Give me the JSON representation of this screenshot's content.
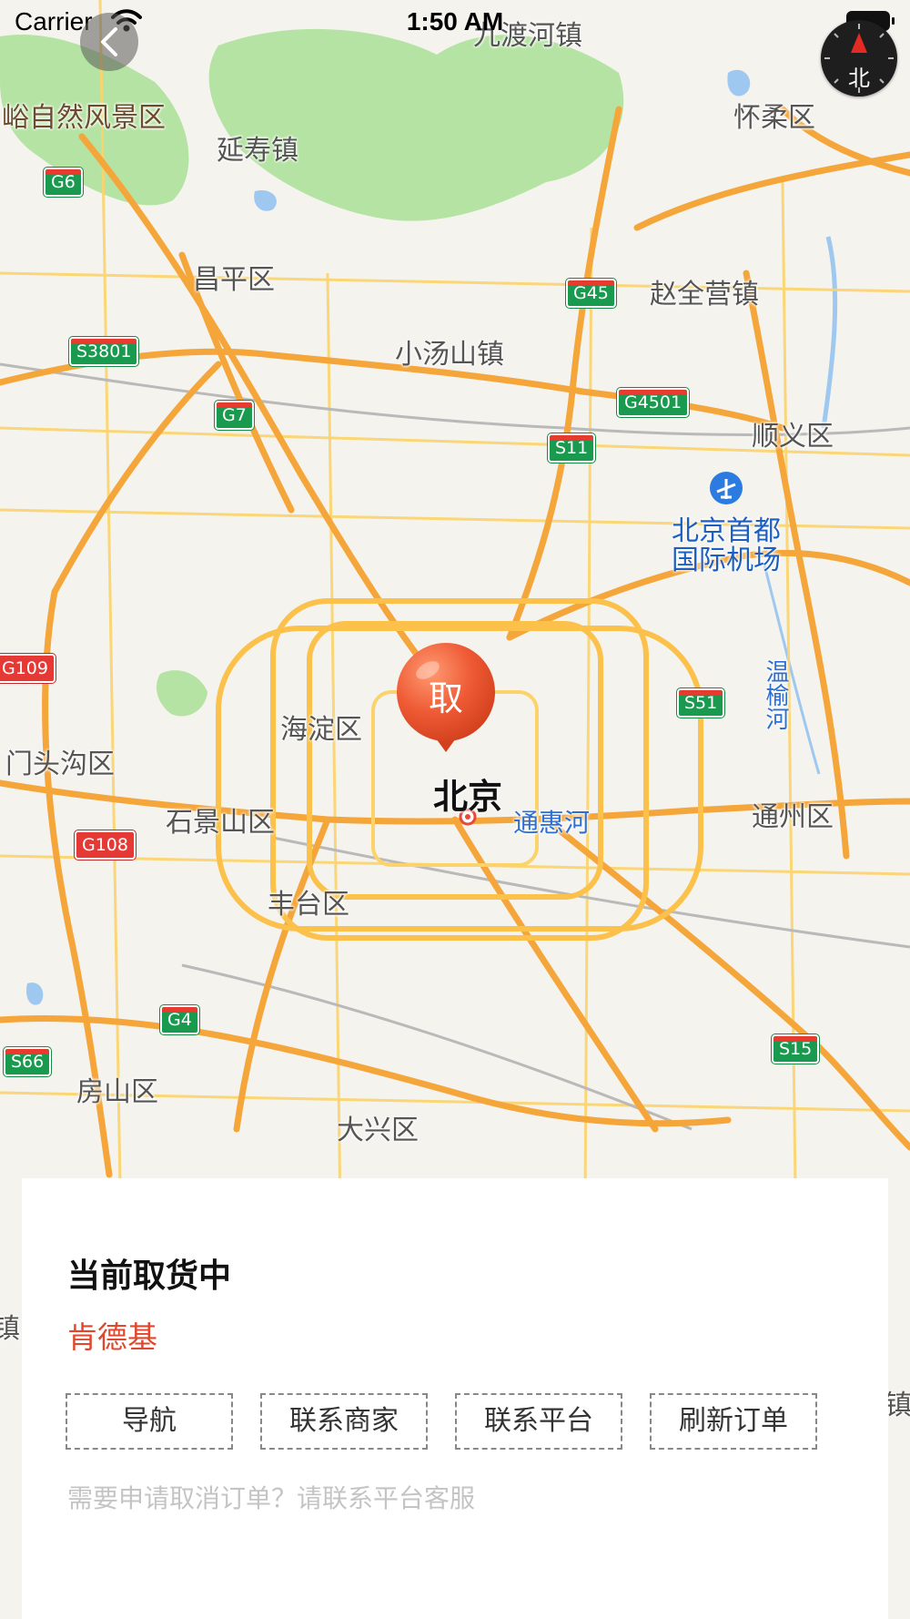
{
  "status_bar": {
    "carrier": "Carrier",
    "time": "1:50 AM"
  },
  "map": {
    "places": [
      {
        "id": "juyongguan",
        "label": "峪自然风景区",
        "kind": "poi"
      },
      {
        "id": "yanshou",
        "label": "延寿镇",
        "kind": "town"
      },
      {
        "id": "jiuduhe",
        "label": "九渡河镇",
        "kind": "town"
      },
      {
        "id": "huairou",
        "label": "怀柔区",
        "kind": "district"
      },
      {
        "id": "changping",
        "label": "昌平区",
        "kind": "district"
      },
      {
        "id": "zhaoquanying",
        "label": "赵全营镇",
        "kind": "town"
      },
      {
        "id": "xiaotangshan",
        "label": "小汤山镇",
        "kind": "town"
      },
      {
        "id": "shunyi",
        "label": "顺义区",
        "kind": "district"
      },
      {
        "id": "airport",
        "label": "北京首都\n国际机场",
        "kind": "airport"
      },
      {
        "id": "haidian",
        "label": "海淀区",
        "kind": "district"
      },
      {
        "id": "mentougou",
        "label": "门头沟区",
        "kind": "district"
      },
      {
        "id": "beijing",
        "label": "北京",
        "kind": "city"
      },
      {
        "id": "tonghuihe",
        "label": "通惠河",
        "kind": "water"
      },
      {
        "id": "wenyuhe",
        "label": "温榆河",
        "kind": "water-vertical"
      },
      {
        "id": "tongzhou",
        "label": "通州区",
        "kind": "district"
      },
      {
        "id": "shijingshan",
        "label": "石景山区",
        "kind": "district"
      },
      {
        "id": "fengtai",
        "label": "丰台区",
        "kind": "district"
      },
      {
        "id": "fangshan",
        "label": "房山区",
        "kind": "district"
      },
      {
        "id": "daxing",
        "label": "大兴区",
        "kind": "district"
      },
      {
        "id": "edge-left",
        "label": "镇",
        "kind": "town"
      },
      {
        "id": "edge-right",
        "label": "镇",
        "kind": "town"
      }
    ],
    "road_shields": [
      {
        "id": "g6",
        "label": "G6",
        "style": "national"
      },
      {
        "id": "g45",
        "label": "G45",
        "style": "national"
      },
      {
        "id": "s3801",
        "label": "S3801",
        "style": "provincial"
      },
      {
        "id": "g7",
        "label": "G7",
        "style": "national"
      },
      {
        "id": "g4501",
        "label": "G4501",
        "style": "national"
      },
      {
        "id": "s11",
        "label": "S11",
        "style": "provincial"
      },
      {
        "id": "g109",
        "label": "G109",
        "style": "red"
      },
      {
        "id": "s51",
        "label": "S51",
        "style": "provincial"
      },
      {
        "id": "g108",
        "label": "G108",
        "style": "red"
      },
      {
        "id": "g4",
        "label": "G4",
        "style": "national"
      },
      {
        "id": "s66",
        "label": "S66",
        "style": "provincial"
      },
      {
        "id": "s15",
        "label": "S15",
        "style": "provincial"
      }
    ],
    "compass_label": "北",
    "pickup_pin_label": "取",
    "colors": {
      "land": "#f5f3ee",
      "park": "#b5e3a3",
      "expressway": "#f5a63b",
      "road": "#fbd36a",
      "water": "#9ec8f0",
      "pin": "#ee5a34"
    }
  },
  "order_panel": {
    "title": "当前取货中",
    "merchant": "肯德基",
    "actions": [
      {
        "id": "navigate",
        "label": "导航"
      },
      {
        "id": "contact-merchant",
        "label": "联系商家"
      },
      {
        "id": "contact-platform",
        "label": "联系平台"
      },
      {
        "id": "refresh-order",
        "label": "刷新订单"
      }
    ],
    "hint": "需要申请取消订单？请联系平台客服"
  }
}
